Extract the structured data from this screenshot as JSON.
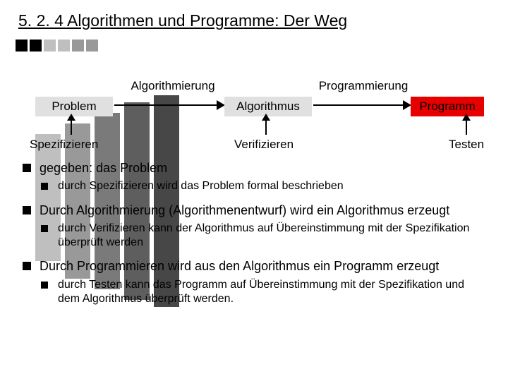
{
  "title": "5. 2. 4  Algorithmen und Programme: Der Weg",
  "diagram": {
    "nodes": {
      "problem": "Problem",
      "algorithm": "Algorithmus",
      "program": "Programm"
    },
    "edges": {
      "e1": "Algorithmierung",
      "e2": "Programmierung"
    },
    "subs": {
      "s1": "Spezifizieren",
      "s2": "Verifizieren",
      "s3": "Testen"
    }
  },
  "bullets": {
    "b1": "gegeben: das Problem",
    "b1a": "durch Spezifizieren wird das Problem formal beschrieben",
    "b2": "Durch Algorithmierung (Algorithmenentwurf) wird ein Algorithmus erzeugt",
    "b2a": "durch Verifizieren kann der Algorithmus auf Übereinstimmung mit der Spezifikation überprüft werden",
    "b3": "Durch Programmieren wird aus den Algorithmus ein Programm erzeugt",
    "b3a": "durch Testen kann das Programm auf Übereinstimmung mit der Spezifikation und dem Algorithmus überprüft werden."
  }
}
